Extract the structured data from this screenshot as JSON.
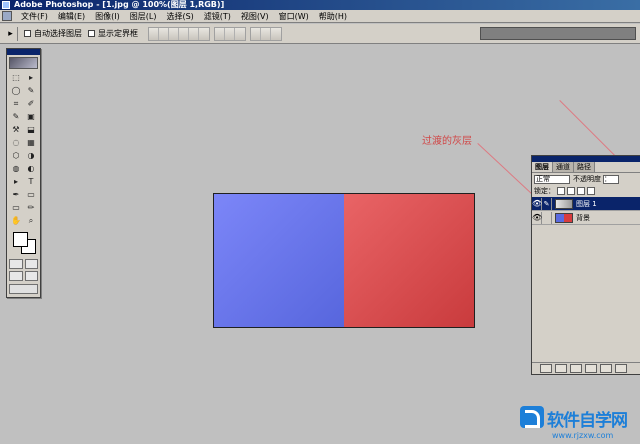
{
  "window": {
    "title": "Adobe Photoshop - [1.jpg @ 100%(图层 1,RGB)]"
  },
  "menubar": {
    "items": [
      "文件(F)",
      "编辑(E)",
      "图像(I)",
      "图层(L)",
      "选择(S)",
      "滤镜(T)",
      "视图(V)",
      "窗口(W)",
      "帮助(H)"
    ]
  },
  "optionsbar": {
    "auto_select": "自动选择图层",
    "show_bounds": "显示定界框"
  },
  "toolbox": {
    "tools": [
      "⬚",
      "▸",
      "◯",
      "✎",
      "⌗",
      "✐",
      "✎",
      "▣",
      "⚒",
      "⬓",
      "◌",
      "▦",
      "⬡",
      "◑",
      "◍",
      "◐",
      "▸",
      "T",
      "✒",
      "▭",
      "▭",
      "✏",
      "✋",
      "⌕"
    ]
  },
  "annotation": {
    "text": "过渡的灰层",
    "color": "#d04848"
  },
  "document": {
    "left_color": "#6a78ee",
    "right_color": "#dd5052"
  },
  "layers_panel": {
    "tabs": [
      "图层",
      "通道",
      "路径"
    ],
    "blend_mode": "正常",
    "opacity_label": "不透明度",
    "opacity_value": "：",
    "lock_label": "锁定：",
    "layers": [
      {
        "name": "图层 1",
        "selected": true
      },
      {
        "name": "背景",
        "selected": false
      }
    ]
  },
  "watermark": {
    "name": "软件自学网",
    "url": "www.rjzxw.com"
  }
}
